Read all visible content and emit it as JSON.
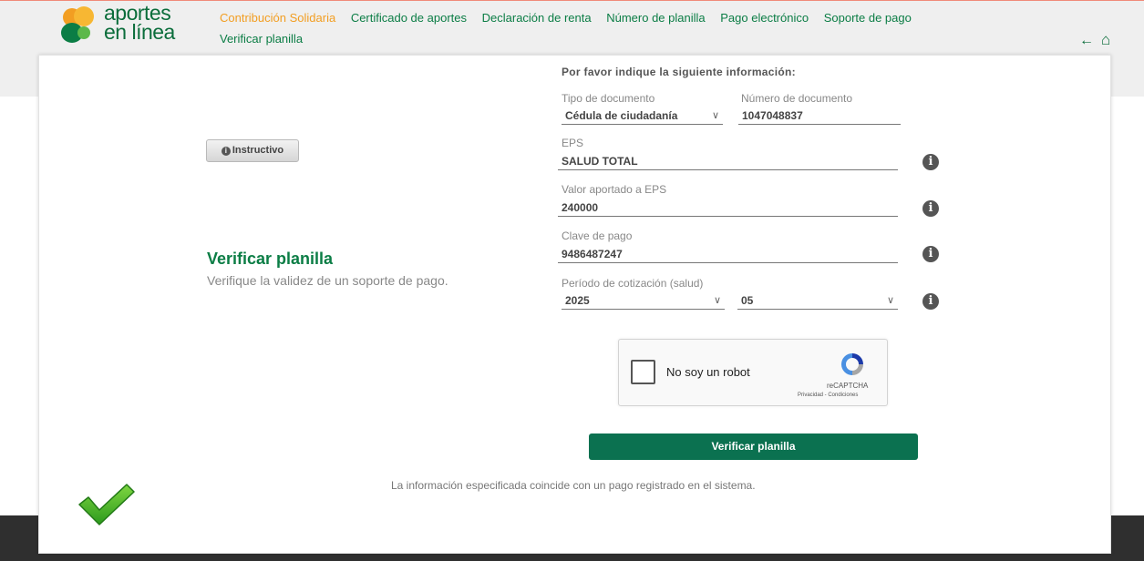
{
  "logo": {
    "line1": "aportes",
    "line2": "en línea"
  },
  "nav": {
    "items": [
      {
        "label": "Contribución Solidaria",
        "active": true
      },
      {
        "label": "Certificado de aportes",
        "active": false
      },
      {
        "label": "Declaración de renta",
        "active": false
      },
      {
        "label": "Número de planilla",
        "active": false
      },
      {
        "label": "Pago electrónico",
        "active": false
      },
      {
        "label": "Soporte de pago",
        "active": false
      },
      {
        "label": "Verificar planilla",
        "active": false
      }
    ],
    "back_icon": "arrow-left-icon",
    "home_icon": "home-icon"
  },
  "left": {
    "instructivo_label": "Instructivo",
    "title": "Verificar planilla",
    "subtitle": "Verifique la validez de un soporte de pago."
  },
  "form": {
    "prompt": "Por favor indique la siguiente información:",
    "tipo_documento": {
      "label": "Tipo de documento",
      "value": "Cédula de ciudadanía"
    },
    "numero_documento": {
      "label": "Número de documento",
      "value": "1047048837"
    },
    "eps": {
      "label": "EPS",
      "value": "SALUD TOTAL"
    },
    "valor_eps": {
      "label": "Valor aportado a EPS",
      "value": "240000"
    },
    "clave_pago": {
      "label": "Clave de pago",
      "value": "9486487247"
    },
    "periodo": {
      "label": "Período de cotización (salud)",
      "year": "2025",
      "month": "05"
    }
  },
  "captcha": {
    "label": "No soy un robot",
    "brand": "reCAPTCHA",
    "terms": "Privacidad - Condiciones"
  },
  "submit_label": "Verificar planilla",
  "result_message": "La información especificada coincide con un pago registrado en el sistema.",
  "colors": {
    "brand_green": "#0b7d45",
    "accent_orange": "#f29e22",
    "button_green": "#0b7150"
  }
}
